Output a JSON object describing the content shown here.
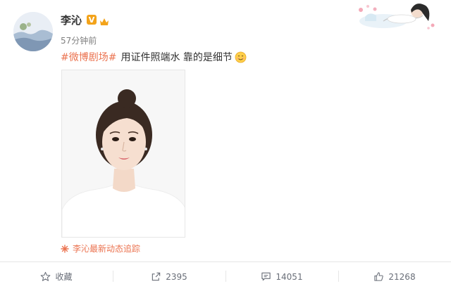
{
  "user": {
    "name": "李沁",
    "vip_label": "V",
    "time": "57分钟前"
  },
  "post": {
    "topic": "#微博剧场#",
    "text": "用证件照端水 靠的是细节",
    "emoji": "smiling-face-emoji"
  },
  "photo": {
    "alt": "证件照"
  },
  "tracker": {
    "label": "李沁最新动态追踪",
    "icon": "sparkle-icon"
  },
  "actions": {
    "favorite_label": "收藏",
    "repost_count": "2395",
    "comment_count": "14051",
    "like_count": "21268"
  },
  "colors": {
    "accent": "#eb7350",
    "vip": "#f3a31a",
    "muted": "#808080"
  }
}
